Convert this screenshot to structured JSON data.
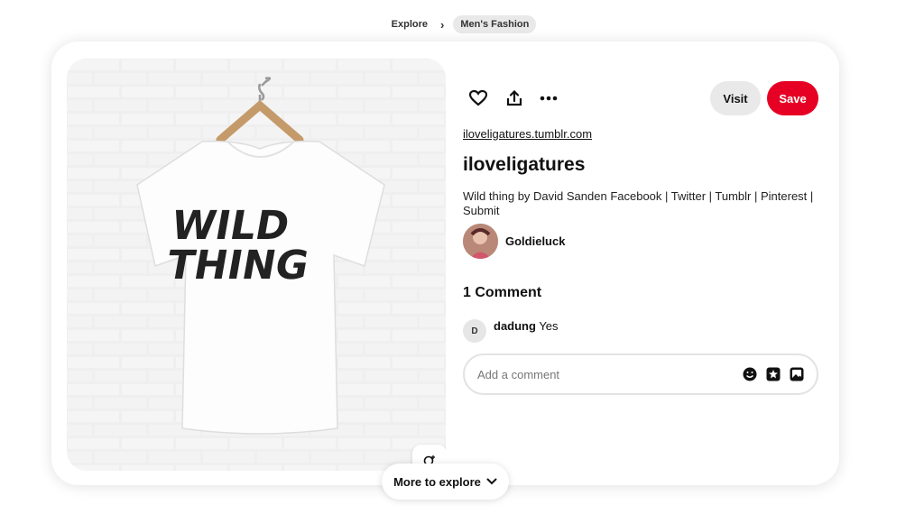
{
  "breadcrumb": {
    "items": [
      "Explore",
      "Men's Fashion"
    ],
    "separator": "›"
  },
  "pin": {
    "image_alt": "White t-shirt reading WILD THING on a hanger against a white brick wall",
    "shirt_text_line1": "WILD",
    "shirt_text_line2": "THING",
    "source_url": "iloveligatures.tumblr.com",
    "title": "iloveligatures",
    "description": "Wild thing by David Sanden Facebook | Twitter | Tumblr | Pinterest | Submit",
    "creator": "Goldieluck"
  },
  "actions": {
    "icons": [
      "heart-icon",
      "share-icon",
      "more-icon"
    ],
    "visit_label": "Visit",
    "save_label": "Save"
  },
  "comments": {
    "title": "1 Comment",
    "items": [
      {
        "avatar_initial": "D",
        "user": "dadung",
        "text": "Yes"
      }
    ],
    "input_placeholder": "Add a comment",
    "input_icons": [
      "emoji-icon",
      "sticker-icon",
      "image-icon"
    ]
  },
  "more_to_explore_label": "More to explore",
  "colors": {
    "save_red": "#e60023",
    "visit_gray": "#e9e9e9",
    "pill_gray": "#e9e9e9"
  }
}
